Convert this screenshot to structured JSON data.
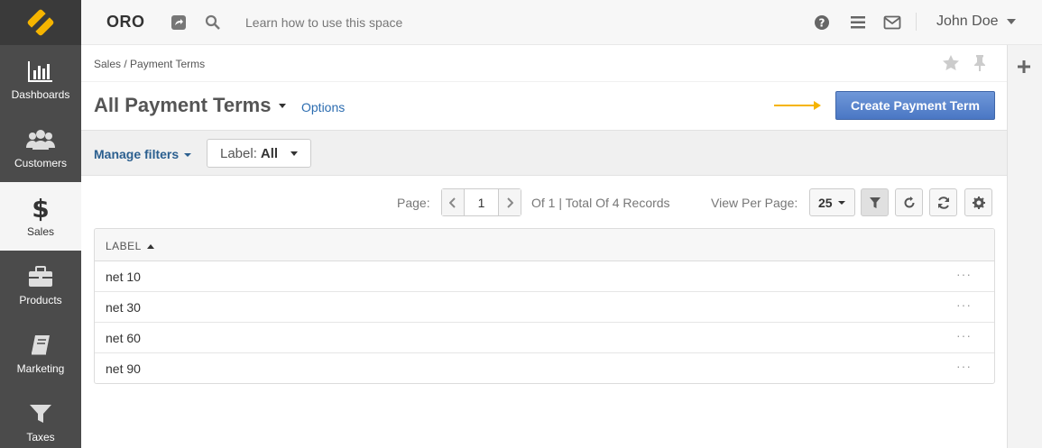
{
  "sidebar": {
    "items": [
      {
        "label": "Dashboards",
        "icon": "bar-chart-icon"
      },
      {
        "label": "Customers",
        "icon": "users-icon"
      },
      {
        "label": "Sales",
        "icon": "dollar-icon",
        "active": true
      },
      {
        "label": "Products",
        "icon": "briefcase-icon"
      },
      {
        "label": "Marketing",
        "icon": "book-icon"
      },
      {
        "label": "Taxes",
        "icon": "filter-icon"
      }
    ]
  },
  "header": {
    "brand": "ORO",
    "hint": "Learn how to use this space",
    "user": "John Doe"
  },
  "breadcrumb": "Sales / Payment Terms",
  "page": {
    "title": "All Payment Terms",
    "options_label": "Options",
    "create_label": "Create Payment Term"
  },
  "filters": {
    "manage_label": "Manage filters",
    "label_filter_name": "Label:",
    "label_filter_value": "All"
  },
  "pagination": {
    "page_label": "Page:",
    "current_page": "1",
    "summary": "Of 1 | Total Of 4 Records",
    "view_per_page_label": "View Per Page:",
    "per_page": "25"
  },
  "grid": {
    "column_label": "LABEL",
    "rows": [
      "net 10",
      "net 30",
      "net 60",
      "net 90"
    ],
    "row_action": "···"
  },
  "colors": {
    "sidebar_bg": "#4b4b4b",
    "accent_button": "#4a77c4",
    "link": "#2b6cb0",
    "arrow": "#f5b400",
    "logo": "#f5b400"
  }
}
